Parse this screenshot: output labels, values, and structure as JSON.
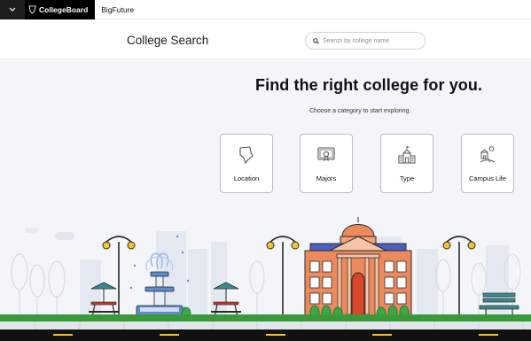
{
  "topbar": {
    "menu_icon": "chevron-down-icon",
    "logo_text": "CollegeBoard",
    "product_label": "BigFuture"
  },
  "header": {
    "title": "College Search",
    "search_placeholder": "Search by college name",
    "search_icon": "search-icon"
  },
  "hero": {
    "title": "Find the right college for you.",
    "subtitle": "Choose a category to start exploring."
  },
  "categories": [
    {
      "label": "Location",
      "icon": "map-icon"
    },
    {
      "label": "Majors",
      "icon": "certificate-icon"
    },
    {
      "label": "Type",
      "icon": "building-icon"
    },
    {
      "label": "Campus Life",
      "icon": "campus-life-icon"
    }
  ],
  "colors": {
    "background": "#f3f5f9",
    "grass": "#3a9a3a",
    "building_brick": "#ec8a5e",
    "roof_blue": "#4a5fbf",
    "fountain_blue": "#5b8bd1",
    "lamp_yellow": "#f4c430",
    "road": "#111111"
  }
}
